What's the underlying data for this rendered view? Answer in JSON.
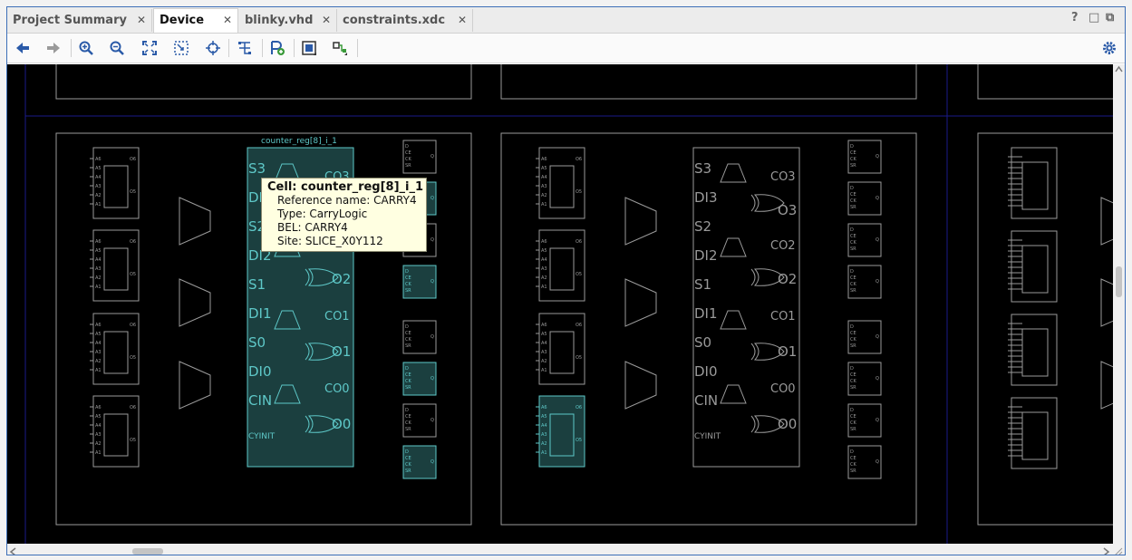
{
  "tabs": [
    {
      "label": "Project Summary",
      "active": false
    },
    {
      "label": "Device",
      "active": true
    },
    {
      "label": "blinky.vhd",
      "active": false
    },
    {
      "label": "constraints.xdc",
      "active": false
    }
  ],
  "window_controls": {
    "help": "?",
    "restore": "□",
    "maximize": "⧉"
  },
  "toolbar": {
    "buttons": [
      "back-icon",
      "forward-icon",
      "zoom-in-icon",
      "zoom-out-icon",
      "zoom-fit-icon",
      "zoom-selection-icon",
      "crosshair-icon",
      "routing-icon",
      "add-pblock-icon",
      "cell-view-icon",
      "connect-icon",
      "settings-icon"
    ]
  },
  "device": {
    "cell_label": "counter_reg[8]_i_1",
    "carry_pins_left": [
      "S3",
      "DI3",
      "S2",
      "DI2",
      "S1",
      "DI1",
      "S0",
      "DI0",
      "CIN",
      "CYINIT"
    ],
    "carry_pins_right": [
      "CO3",
      "O3",
      "CO2",
      "O2",
      "CO1",
      "O1",
      "CO0",
      "O0"
    ],
    "lut_pins": [
      "A6",
      "A5",
      "A4",
      "A3",
      "A2",
      "A1"
    ],
    "ff_pins": [
      "D",
      "CE",
      "CK",
      "SR"
    ],
    "ff_out": "Q"
  },
  "tooltip": {
    "title": "Cell: counter_reg[8]_i_1",
    "ref": "Reference name: CARRY4",
    "type": "Type: CarryLogic",
    "bel": "BEL: CARRY4",
    "site": "Site: SLICE_X0Y112"
  },
  "colors": {
    "accent": "#3d6fb8",
    "highlight_fill": "#1b3f3f",
    "highlight_stroke": "#5ec8c8",
    "wire": "#9a9a9a",
    "grid": "#1a1a8a"
  }
}
